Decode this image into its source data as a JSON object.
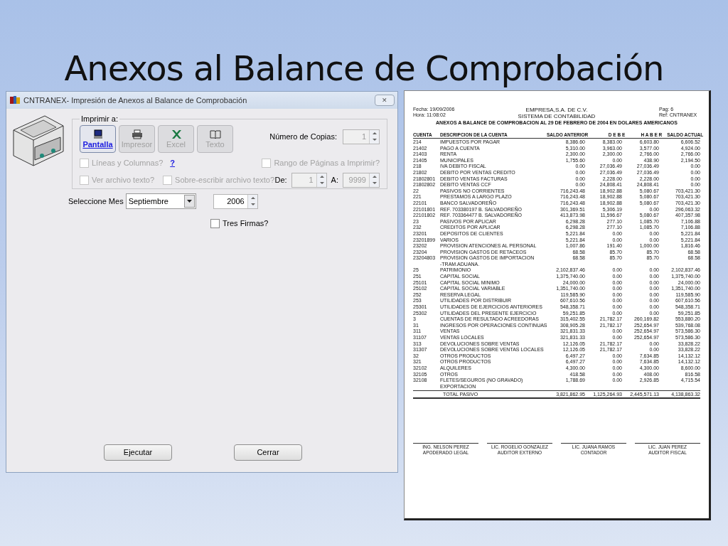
{
  "slide_title": "Anexos al Balance de Comprobación",
  "dialog": {
    "title": "CNTRANEX- Impresión de Anexos al Balance de Comprobación",
    "close": "✕",
    "output_group": {
      "legend": "Imprimir a:",
      "targets": [
        {
          "label": "Pantalla",
          "kind": "screen",
          "selected": true,
          "disabled": false
        },
        {
          "label": "Impresor",
          "kind": "printer",
          "selected": false,
          "disabled": true
        },
        {
          "label": "Excel",
          "kind": "excel",
          "selected": false,
          "disabled": true
        },
        {
          "label": "Texto",
          "kind": "book",
          "selected": false,
          "disabled": true
        }
      ],
      "copies": {
        "label": "Número de Copias:",
        "value": "1",
        "disabled": true
      },
      "checkboxes": [
        {
          "label": "Líneas y Columnas?",
          "checked": false,
          "disabled": true
        },
        {
          "label": "Ver archivo texto?",
          "checked": false,
          "disabled": true
        },
        {
          "label": "Sobre-escribir archivo texto?",
          "checked": false,
          "disabled": true
        },
        {
          "label": "Rango de Páginas a Imprimir?",
          "checked": false,
          "disabled": true
        }
      ],
      "help_link": "?",
      "range": {
        "from_label": "De:",
        "from": "1",
        "to_label": "A:",
        "to": "9999",
        "disabled": true
      }
    },
    "month": {
      "label": "Seleccione Mes",
      "value": "Septiembre"
    },
    "year": "2006",
    "tres_firmas": {
      "label": "Tres Firmas?",
      "checked": false,
      "disabled": false
    },
    "buttons": [
      "Ejecutar",
      "Cerrar"
    ]
  },
  "report": {
    "date": "Fecha: 19/09/2006",
    "time": "Hora: 11:08:02",
    "page": "Pag:  6",
    "ref": "Ref: CNTRANEX",
    "company": "EMPRESA,S.A. DE C.V.",
    "system": "SISTEMA DE CONTABILIDAD",
    "title": "ANEXOS A BALANCE DE COMPROBACION  AL 29 DE FEBRERO DE 2004  EN DOLARES AMERICANOS",
    "columns": [
      "CUENTA",
      "DESCRIPCION DE LA CUENTA",
      "SALDO ANTERIOR",
      "D E B E",
      "H A B E R",
      "SALDO ACTUAL"
    ],
    "rows": [
      [
        "214",
        "IMPUESTOS POR PAGAR",
        "8,386.60",
        "8,383.00",
        "6,603.80",
        "6,606.52"
      ],
      [
        "21402",
        "PAGO A CUENTA",
        "5,310.00",
        "3,963.00",
        "3,577.00",
        "4,924.00"
      ],
      [
        "21403",
        "RENTA",
        "2,300.00",
        "2,300.00",
        "2,766.00",
        "2,766.00"
      ],
      [
        "21405",
        "MUNICIPALES",
        "1,755.60",
        "0.00",
        "438.90",
        "2,194.50"
      ],
      [
        "218",
        "IVA DEBITO FISCAL",
        "0.00",
        "27,036.49",
        "27,036.49",
        "0.00"
      ],
      [
        "21802",
        "DEBITO POR VENTAS CREDITO",
        "0.00",
        "27,036.49",
        "27,036.49",
        "0.00"
      ],
      [
        "21802801",
        "DEBITO VENTAS FACTURAS",
        "0.00",
        "2,228.00",
        "2,228.00",
        "0.00"
      ],
      [
        "21802802",
        "DEBITO VENTAS CCF",
        "0.00",
        "24,808.41",
        "24,808.41",
        "0.00"
      ],
      [
        "22",
        "PASIVOS NO CORRIENTES",
        "716,243.48",
        "18,902.88",
        "5,080.67",
        "703,421.30"
      ],
      [
        "221",
        "PRESTAMOS A LARGO PLAZO",
        "716,243.48",
        "18,902.88",
        "5,080.67",
        "703,421.30"
      ],
      [
        "22101",
        "BANCO SALVADOREÑO",
        "716,243.48",
        "18,902.88",
        "5,080.67",
        "703,421.30"
      ],
      [
        "22101801",
        "REF. 703380197 B. SALVADOREÑO",
        "301,369.51",
        "5,306.19",
        "0.00",
        "296,063.32"
      ],
      [
        "22101802",
        "REF. 703364477 B. SALVADOREÑO",
        "413,873.98",
        "11,596.67",
        "5,080.67",
        "407,357.98"
      ],
      [
        "23",
        "PASIVOS POR APLICAR",
        "6,298.28",
        "277.10",
        "1,085.70",
        "7,106.88"
      ],
      [
        "232",
        "CREDITOS POR APLICAR",
        "6,298.28",
        "277.10",
        "1,085.70",
        "7,106.88"
      ],
      [
        "23201",
        "DEPOSITOS DE CLIENTES",
        "5,221.84",
        "0.00",
        "0.00",
        "5,221.84"
      ],
      [
        "23201899",
        "VARIOS",
        "5,221.84",
        "0.00",
        "0.00",
        "5,221.84"
      ],
      [
        "23202",
        "PROVISION ATENCIONES AL PERSONAL",
        "1,007.86",
        "191.40",
        "1,000.00",
        "1,816.46"
      ],
      [
        "23204",
        "PROVISION GASTOS DE RETACEOS",
        "68.58",
        "85.70",
        "85.70",
        "68.58"
      ],
      [
        "23204803",
        "PROVISION GASTOS DE IMPORTACION",
        "68.58",
        "85.70",
        "85.70",
        "68.58",
        "-TRAM.ADUANA."
      ],
      [
        "25",
        "PATRIMONIO",
        "2,102,837.46",
        "0.00",
        "0.00",
        "2,102,837.46"
      ],
      [
        "251",
        "CAPITAL SOCIAL",
        "1,375,740.00",
        "0.00",
        "0.00",
        "1,375,740.00"
      ],
      [
        "25101",
        "CAPITAL SOCIAL MINIMO",
        "24,000.00",
        "0.00",
        "0.00",
        "24,000.00"
      ],
      [
        "25102",
        "CAPITAL SOCIAL VARIABLE",
        "1,351,740.00",
        "0.00",
        "0.00",
        "1,351,740.00"
      ],
      [
        "252",
        "RESERVA LEGAL",
        "119,585.90",
        "0.00",
        "0.00",
        "119,585.90"
      ],
      [
        "253",
        "UTILIDADES POR DISTRIBUIR",
        "607,610.56",
        "0.00",
        "0.00",
        "607,610.56"
      ],
      [
        "25301",
        "UTILIDADES DE EJERCICIOS ANTERIORES",
        "548,358.71",
        "0.00",
        "0.00",
        "548,358.71"
      ],
      [
        "25302",
        "UTILIDADES DEL PRESENTE EJERCICIO",
        "59,251.85",
        "0.00",
        "0.00",
        "59,251.85"
      ],
      [
        "3",
        "CUENTAS DE RESULTADO ACREEDORAS",
        "315,402.55",
        "21,782.17",
        "260,169.82",
        "553,880.20"
      ],
      [
        "31",
        "INGRESOS POR OPERACIONES CONTINUAS",
        "308,905.28",
        "21,782.17",
        "252,654.97",
        "539,768.08"
      ],
      [
        "311",
        "VENTAS",
        "321,831.33",
        "0.00",
        "252,654.97",
        "573,586.30"
      ],
      [
        "31107",
        "VENTAS LOCALES",
        "321,831.33",
        "0.00",
        "252,654.97",
        "573,586.30"
      ],
      [
        "313",
        "DEVOLUCIONES SOBRE VENTAS",
        "12,126.05",
        "21,782.17",
        "0.00",
        "33,828.22"
      ],
      [
        "31307",
        "DEVOLUCIONES SOBRE VENTAS LOCALES",
        "12,126.05",
        "21,782.17",
        "0.00",
        "33,828.22"
      ],
      [
        "32",
        "OTROS PRODUCTOS",
        "6,497.27",
        "0.00",
        "7,634.85",
        "14,132.12"
      ],
      [
        "321",
        "OTROS PRODUCTOS",
        "6,497.27",
        "0.00",
        "7,634.85",
        "14,132.12"
      ],
      [
        "32102",
        "ALQUILERES",
        "4,300.00",
        "0.00",
        "4,300.00",
        "8,600.00"
      ],
      [
        "32105",
        "OTROS",
        "418.58",
        "0.00",
        "408.00",
        "816.58"
      ],
      [
        "32108",
        "FLETES/SEGUROS (NO GRAVADO)",
        "1,788.69",
        "0.00",
        "2,926.85",
        "4,715.54",
        "EXPORTACION"
      ]
    ],
    "total": [
      "TOTAL PASIVO",
      "3,821,862.95",
      "1,125,264.93",
      "2,445,571.13",
      "4,138,863.32"
    ],
    "signatures": [
      [
        "ING. NELSON PEREZ",
        "APODERADO LEGAL"
      ],
      [
        "LIC. ROGELIO GONZALEZ",
        "AUDITOR EXTERNO"
      ],
      [
        "LIC. JUANA RAMOS",
        "CONTADOR"
      ],
      [
        "LIC. JUAN PEREZ",
        "AUDITOR FISCAL"
      ]
    ]
  }
}
